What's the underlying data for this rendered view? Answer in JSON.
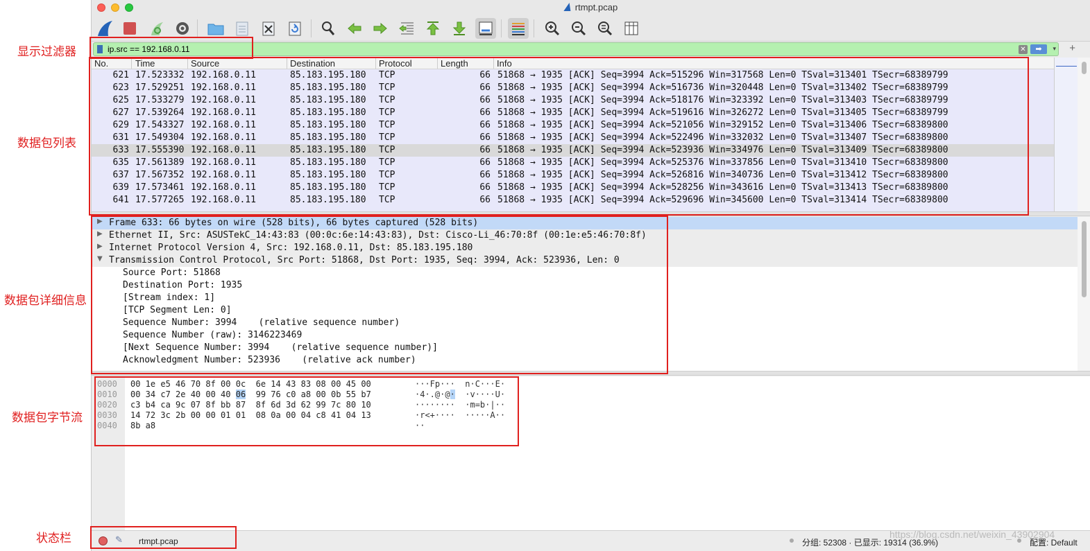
{
  "annotations": {
    "filter": "显示过滤器",
    "packet_list": "数据包列表",
    "packet_details": "数据包详细信息",
    "packet_bytes": "数据包字节流",
    "status_bar": "状态栏"
  },
  "window": {
    "title": "rtmpt.pcap"
  },
  "toolbar": {
    "icons": [
      "shark-fin-icon",
      "stop-icon",
      "restart-icon",
      "options-icon",
      "open-folder-icon",
      "save-icon",
      "close-file-icon",
      "reload-icon",
      "find-icon",
      "go-back-icon",
      "go-forward-icon",
      "go-to-packet-icon",
      "first-packet-icon",
      "last-packet-icon",
      "autoscroll-icon",
      "colorize-icon",
      "zoom-in-icon",
      "zoom-out-icon",
      "normal-size-icon",
      "resize-columns-icon"
    ]
  },
  "filter": {
    "value": "ip.src == 192.168.0.11",
    "plus": "+"
  },
  "packet_list": {
    "columns": [
      "No.",
      "Time",
      "Source",
      "Destination",
      "Protocol",
      "Length",
      "Info"
    ],
    "selected_no": "633",
    "rows": [
      {
        "no": "621",
        "time": "17.523332",
        "src": "192.168.0.11",
        "dst": "85.183.195.180",
        "proto": "TCP",
        "len": "66",
        "info": "51868 → 1935 [ACK] Seq=3994 Ack=515296 Win=317568 Len=0 TSval=313401 TSecr=68389799"
      },
      {
        "no": "623",
        "time": "17.529251",
        "src": "192.168.0.11",
        "dst": "85.183.195.180",
        "proto": "TCP",
        "len": "66",
        "info": "51868 → 1935 [ACK] Seq=3994 Ack=516736 Win=320448 Len=0 TSval=313402 TSecr=68389799"
      },
      {
        "no": "625",
        "time": "17.533279",
        "src": "192.168.0.11",
        "dst": "85.183.195.180",
        "proto": "TCP",
        "len": "66",
        "info": "51868 → 1935 [ACK] Seq=3994 Ack=518176 Win=323392 Len=0 TSval=313403 TSecr=68389799"
      },
      {
        "no": "627",
        "time": "17.539264",
        "src": "192.168.0.11",
        "dst": "85.183.195.180",
        "proto": "TCP",
        "len": "66",
        "info": "51868 → 1935 [ACK] Seq=3994 Ack=519616 Win=326272 Len=0 TSval=313405 TSecr=68389799"
      },
      {
        "no": "629",
        "time": "17.543327",
        "src": "192.168.0.11",
        "dst": "85.183.195.180",
        "proto": "TCP",
        "len": "66",
        "info": "51868 → 1935 [ACK] Seq=3994 Ack=521056 Win=329152 Len=0 TSval=313406 TSecr=68389800"
      },
      {
        "no": "631",
        "time": "17.549304",
        "src": "192.168.0.11",
        "dst": "85.183.195.180",
        "proto": "TCP",
        "len": "66",
        "info": "51868 → 1935 [ACK] Seq=3994 Ack=522496 Win=332032 Len=0 TSval=313407 TSecr=68389800"
      },
      {
        "no": "633",
        "time": "17.555390",
        "src": "192.168.0.11",
        "dst": "85.183.195.180",
        "proto": "TCP",
        "len": "66",
        "info": "51868 → 1935 [ACK] Seq=3994 Ack=523936 Win=334976 Len=0 TSval=313409 TSecr=68389800"
      },
      {
        "no": "635",
        "time": "17.561389",
        "src": "192.168.0.11",
        "dst": "85.183.195.180",
        "proto": "TCP",
        "len": "66",
        "info": "51868 → 1935 [ACK] Seq=3994 Ack=525376 Win=337856 Len=0 TSval=313410 TSecr=68389800"
      },
      {
        "no": "637",
        "time": "17.567352",
        "src": "192.168.0.11",
        "dst": "85.183.195.180",
        "proto": "TCP",
        "len": "66",
        "info": "51868 → 1935 [ACK] Seq=3994 Ack=526816 Win=340736 Len=0 TSval=313412 TSecr=68389800"
      },
      {
        "no": "639",
        "time": "17.573461",
        "src": "192.168.0.11",
        "dst": "85.183.195.180",
        "proto": "TCP",
        "len": "66",
        "info": "51868 → 1935 [ACK] Seq=3994 Ack=528256 Win=343616 Len=0 TSval=313413 TSecr=68389800"
      },
      {
        "no": "641",
        "time": "17.577265",
        "src": "192.168.0.11",
        "dst": "85.183.195.180",
        "proto": "TCP",
        "len": "66",
        "info": "51868 → 1935 [ACK] Seq=3994 Ack=529696 Win=345600 Len=0 TSval=313414 TSecr=68389800"
      }
    ]
  },
  "packet_details": {
    "rows": [
      {
        "level": 0,
        "expanded": false,
        "selected": true,
        "text": "Frame 633: 66 bytes on wire (528 bits), 66 bytes captured (528 bits)"
      },
      {
        "level": 0,
        "expanded": false,
        "selected": false,
        "text": "Ethernet II, Src: ASUSTekC_14:43:83 (00:0c:6e:14:43:83), Dst: Cisco-Li_46:70:8f (00:1e:e5:46:70:8f)"
      },
      {
        "level": 0,
        "expanded": false,
        "selected": false,
        "text": "Internet Protocol Version 4, Src: 192.168.0.11, Dst: 85.183.195.180"
      },
      {
        "level": 0,
        "expanded": true,
        "selected": false,
        "text": "Transmission Control Protocol, Src Port: 51868, Dst Port: 1935, Seq: 3994, Ack: 523936, Len: 0"
      },
      {
        "level": 1,
        "text": "Source Port: 51868"
      },
      {
        "level": 1,
        "text": "Destination Port: 1935"
      },
      {
        "level": 1,
        "text": "[Stream index: 1]"
      },
      {
        "level": 1,
        "text": "[TCP Segment Len: 0]"
      },
      {
        "level": 1,
        "text": "Sequence Number: 3994    (relative sequence number)"
      },
      {
        "level": 1,
        "text": "Sequence Number (raw): 3146223469"
      },
      {
        "level": 1,
        "text": "[Next Sequence Number: 3994    (relative sequence number)]"
      },
      {
        "level": 1,
        "text": "Acknowledgment Number: 523936    (relative ack number)"
      }
    ]
  },
  "packet_bytes": {
    "rows": [
      {
        "offset": "0000",
        "hex_a": "00 1e e5 46 70 8f 00 0c  6e 14 43 83 08 00 45 00",
        "hex_hl": "",
        "hex_b": "",
        "ascii_a": "···Fp···  n·C···E·",
        "ascii_hl": "",
        "ascii_b": ""
      },
      {
        "offset": "0010",
        "hex_a": "00 34 c7 2e 40 00 40 ",
        "hex_hl": "06",
        "hex_b": "  99 76 c0 a8 00 0b 55 b7",
        "ascii_a": "·4·.@·@",
        "ascii_hl": "·",
        "ascii_b": "  ·v····U·"
      },
      {
        "offset": "0020",
        "hex_a": "c3 b4 ca 9c 07 8f bb 87  8f 6d 3d 62 99 7c 80 10",
        "hex_hl": "",
        "hex_b": "",
        "ascii_a": "········  ·m=b·|··",
        "ascii_hl": "",
        "ascii_b": ""
      },
      {
        "offset": "0030",
        "hex_a": "14 72 3c 2b 00 00 01 01  08 0a 00 04 c8 41 04 13",
        "hex_hl": "",
        "hex_b": "",
        "ascii_a": "·r<+····  ·····A··",
        "ascii_hl": "",
        "ascii_b": ""
      },
      {
        "offset": "0040",
        "hex_a": "8b a8",
        "hex_hl": "",
        "hex_b": "",
        "ascii_a": "··",
        "ascii_hl": "",
        "ascii_b": ""
      }
    ]
  },
  "status": {
    "file": "rtmpt.pcap",
    "stats": "分组: 52308 · 已显示: 19314 (36.9%)",
    "profile": "配置: Default"
  },
  "watermark": "https://blog.csdn.net/weixin_43902904",
  "colors": {
    "annotation": "#e02020",
    "filter_ok": "#b5f0b0",
    "row_bg": "#e8e8fa",
    "row_selected": "#d9d9d9",
    "detail_selected": "#c2d9f7"
  }
}
